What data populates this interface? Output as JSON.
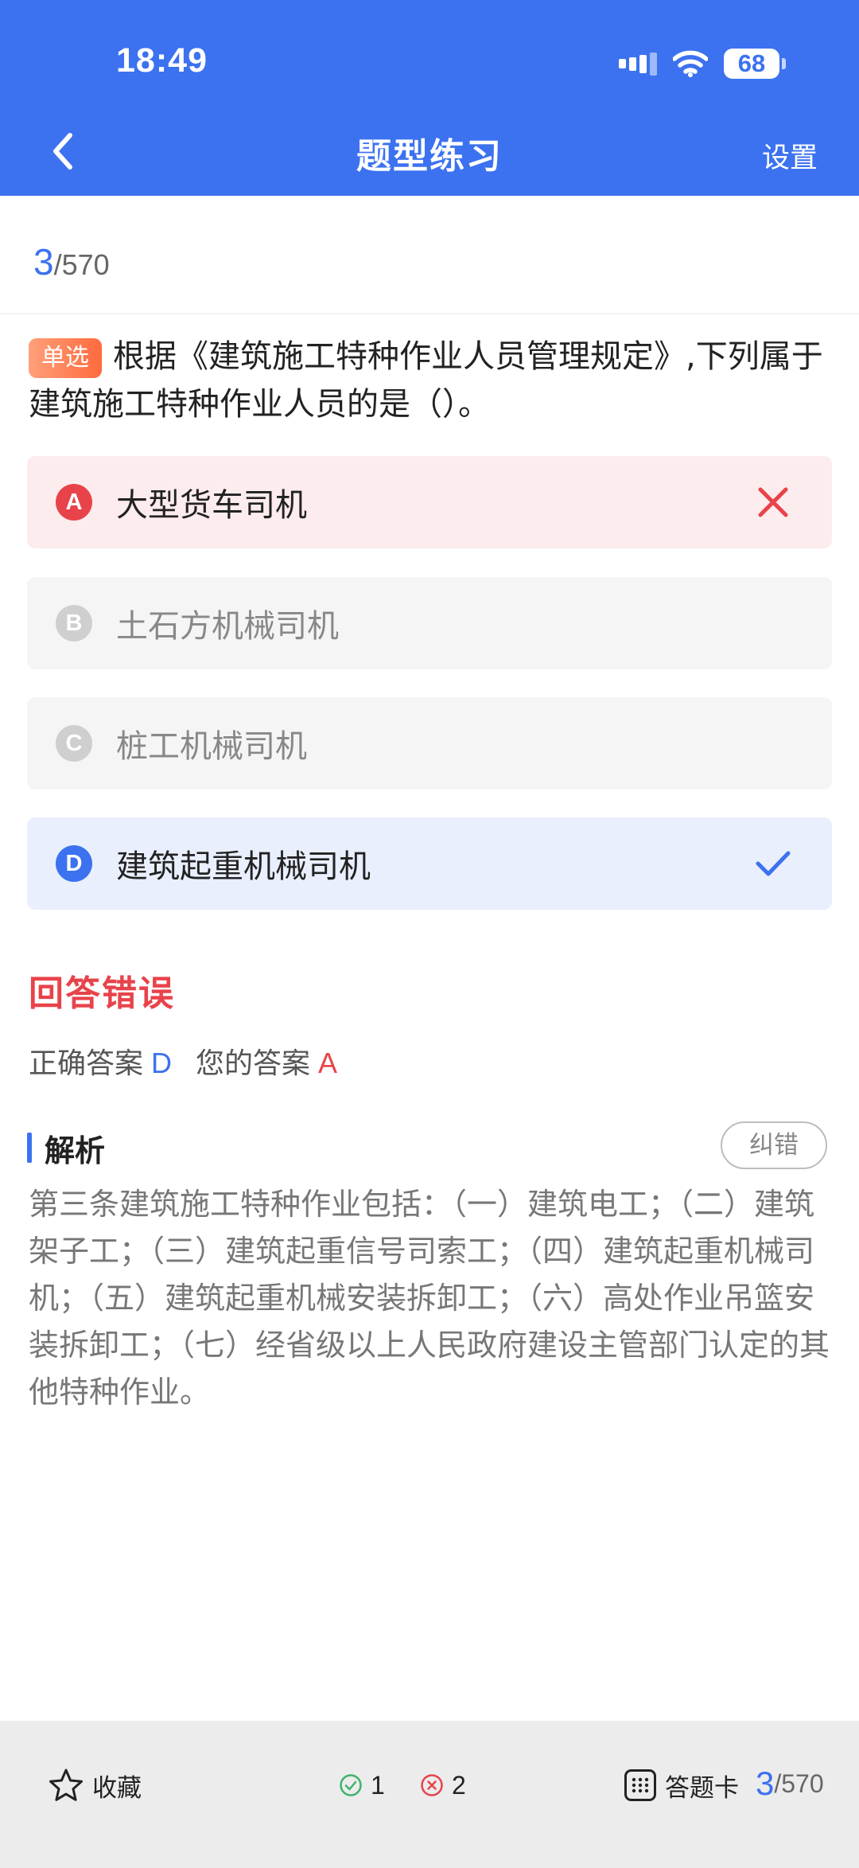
{
  "status_bar": {
    "time": "18:49",
    "battery": "68"
  },
  "nav": {
    "title": "题型练习",
    "settings": "设置"
  },
  "progress": {
    "current": "3",
    "total": "/570"
  },
  "question": {
    "type_badge": "单选",
    "text": "根据《建筑施工特种作业人员管理规定》,下列属于建筑施工特种作业人员的是（）。"
  },
  "options": [
    {
      "letter": "A",
      "text": "大型货车司机",
      "state": "wrong"
    },
    {
      "letter": "B",
      "text": "土石方机械司机",
      "state": "normal"
    },
    {
      "letter": "C",
      "text": "桩工机械司机",
      "state": "normal"
    },
    {
      "letter": "D",
      "text": "建筑起重机械司机",
      "state": "correct"
    }
  ],
  "result": {
    "title": "回答错误",
    "correct_label": "正确答案",
    "correct_value": "D",
    "your_label": "您的答案",
    "your_value": "A"
  },
  "analysis": {
    "title": "解析",
    "report_button": "纠错",
    "text": "第三条建筑施工特种作业包括：（一）建筑电工；（二）建筑架子工；（三）建筑起重信号司索工；（四）建筑起重机械司机；（五）建筑起重机械安装拆卸工；（六）高处作业吊篮安装拆卸工；（七）经省级以上人民政府建设主管部门认定的其他特种作业。"
  },
  "bottom_bar": {
    "favorite": "收藏",
    "correct_count": "1",
    "wrong_count": "2",
    "answer_card": "答题卡",
    "current": "3",
    "total": "/570"
  },
  "colors": {
    "primary": "#3c72f0",
    "error": "#e8434a",
    "success": "#3fb36b"
  },
  "icons": [
    "chevron-left-icon",
    "signal-icon",
    "wifi-icon",
    "battery-icon",
    "close-icon",
    "check-icon",
    "star-icon",
    "check-circle-icon",
    "x-circle-icon",
    "grid-icon"
  ]
}
